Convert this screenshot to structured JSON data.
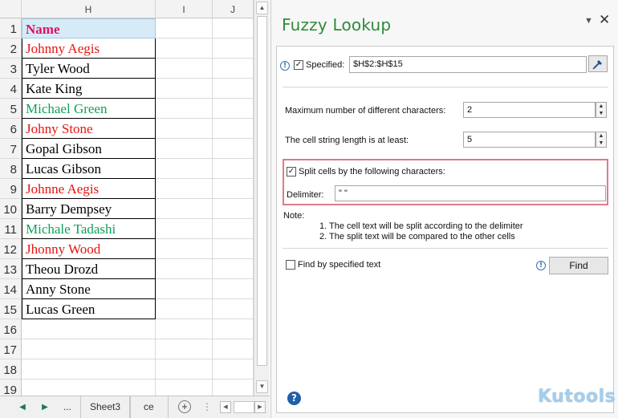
{
  "sheet": {
    "columns": [
      "H",
      "I",
      "J"
    ],
    "header_cell": "Name",
    "rows": [
      {
        "num": "1",
        "text": "",
        "color": "header"
      },
      {
        "num": "2",
        "text": "Johnny Aegis",
        "color": "red"
      },
      {
        "num": "3",
        "text": "Tyler Wood",
        "color": "black"
      },
      {
        "num": "4",
        "text": "Kate King",
        "color": "black"
      },
      {
        "num": "5",
        "text": "Michael Green",
        "color": "green"
      },
      {
        "num": "6",
        "text": "Johny Stone",
        "color": "red"
      },
      {
        "num": "7",
        "text": "Gopal Gibson",
        "color": "black"
      },
      {
        "num": "8",
        "text": "Lucas Gibson",
        "color": "black"
      },
      {
        "num": "9",
        "text": "Johnne Aegis",
        "color": "red"
      },
      {
        "num": "10",
        "text": "Barry Dempsey",
        "color": "black"
      },
      {
        "num": "11",
        "text": "Michale Tadashi",
        "color": "green"
      },
      {
        "num": "12",
        "text": "Jhonny Wood",
        "color": "red"
      },
      {
        "num": "13",
        "text": "Theou Drozd",
        "color": "black"
      },
      {
        "num": "14",
        "text": "Anny Stone",
        "color": "black"
      },
      {
        "num": "15",
        "text": "Lucas Green",
        "color": "black"
      },
      {
        "num": "16",
        "text": "",
        "color": "none"
      },
      {
        "num": "17",
        "text": "",
        "color": "none"
      },
      {
        "num": "18",
        "text": "",
        "color": "none"
      },
      {
        "num": "19",
        "text": "",
        "color": "none"
      }
    ],
    "tabbar": {
      "prev_icon": "◀",
      "next_icon": "▶",
      "ellipsis": "...",
      "sheet_tab": "Sheet3",
      "partial_tab": "ce",
      "add_icon": "+",
      "menu_dots": "⋮",
      "scroll_left": "◀",
      "scroll_right": "▶"
    },
    "vscroll_up": "▲",
    "vscroll_down": "▼"
  },
  "pane": {
    "title": "Fuzzy Lookup",
    "menu_icon": "▼",
    "close_icon": "✕",
    "range_info_icon": "!",
    "specified_checked": "✓",
    "specified_label": "Specified:",
    "range_value": "$H$2:$H$15",
    "max_diff_label": "Maximum number of different characters:",
    "max_diff_value": "2",
    "min_length_label": "The cell string length is at least:",
    "min_length_value": "5",
    "spin_up": "▲",
    "spin_down": "▼",
    "split_checked": "✓",
    "split_label": "Split cells by the following characters:",
    "delimiter_label": "Delimiter:",
    "delimiter_value": "\" \"",
    "note_label": "Note:",
    "note_lines": [
      "1. The cell text will be split according to the delimiter",
      "2. The split text will be compared to the other cells"
    ],
    "find_specified_label": "Find by specified text",
    "find_info_icon": "!",
    "find_button": "Find",
    "help_icon": "?",
    "brand": "Kutools"
  },
  "colors": {
    "red": "#e8140f",
    "green": "#10a05a",
    "header_text": "#e0115f",
    "title_green": "#2f8a3c",
    "highlight_border": "#e07b8a"
  }
}
